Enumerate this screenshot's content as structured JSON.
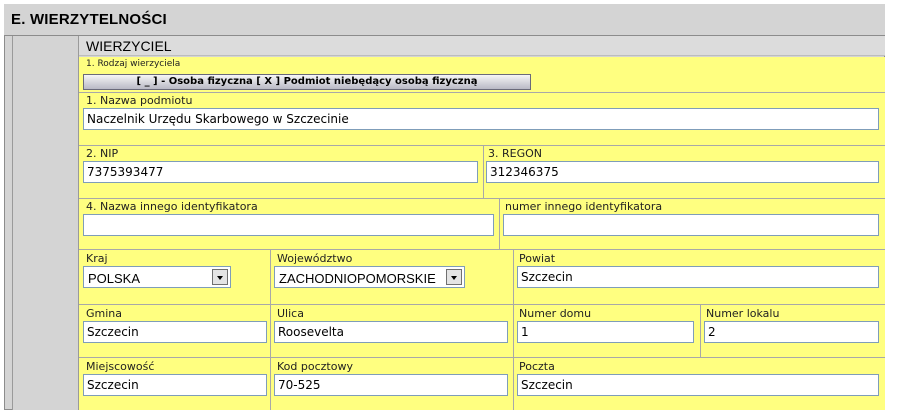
{
  "section": {
    "title": "E. WIERZYTELNOŚCI"
  },
  "creditor": {
    "title": "WIERZYCIEL",
    "type_label": "1. Rodzaj wierzyciela",
    "type_value": "[ _ ] - Osoba fizyczna [ X ] Podmiot niebędący osobą fizyczną",
    "name": {
      "label": "1. Nazwa podmiotu",
      "value": "Naczelnik Urzędu Skarbowego w Szczecinie"
    },
    "nip": {
      "label": "2. NIP",
      "value": "7375393477"
    },
    "regon": {
      "label": "3. REGON",
      "value": "312346375"
    },
    "other_id_name": {
      "label": "4. Nazwa innego identyfikatora",
      "value": ""
    },
    "other_id_number": {
      "label": "numer innego identyfikatora",
      "value": ""
    }
  },
  "address": {
    "country": {
      "label": "Kraj",
      "value": "POLSKA"
    },
    "voivodeship": {
      "label": "Województwo",
      "value": "ZACHODNIOPOMORSKIE"
    },
    "county": {
      "label": "Powiat",
      "value": "Szczecin"
    },
    "municipality": {
      "label": "Gmina",
      "value": "Szczecin"
    },
    "street": {
      "label": "Ulica",
      "value": "Roosevelta"
    },
    "house_number": {
      "label": "Numer domu",
      "value": "1"
    },
    "apartment_number": {
      "label": "Numer lokalu",
      "value": "2"
    },
    "city": {
      "label": "Miejscowość",
      "value": "Szczecin"
    },
    "postal_code": {
      "label": "Kod pocztowy",
      "value": "70-525"
    },
    "post_office": {
      "label": "Poczta",
      "value": "Szczecin"
    }
  }
}
